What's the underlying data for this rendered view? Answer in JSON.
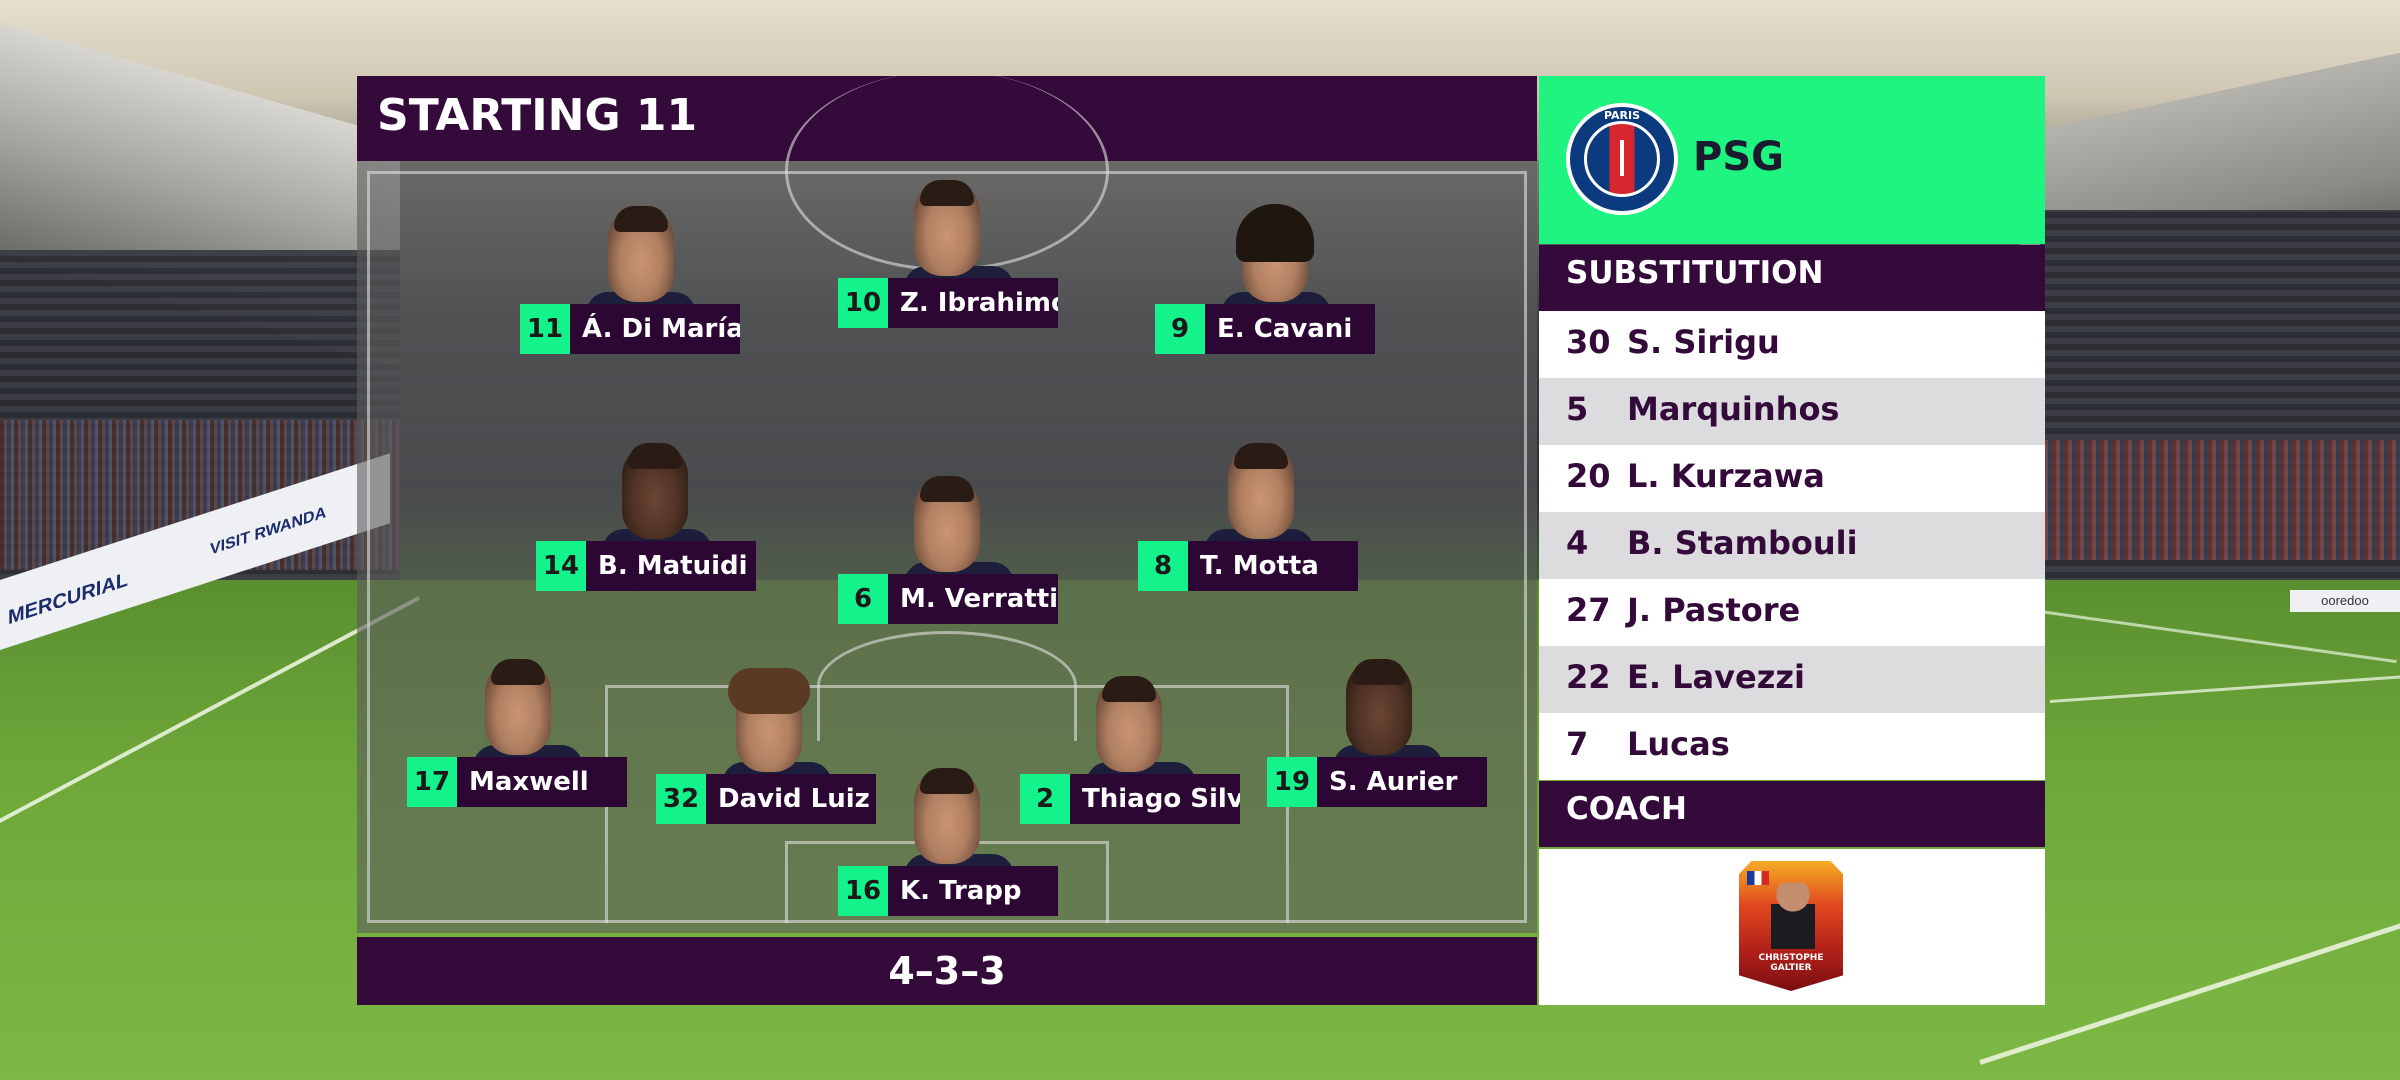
{
  "starting": {
    "title": "STARTING 11",
    "formation": "4–3–3",
    "players": [
      {
        "number": "11",
        "name": "Á. Di María"
      },
      {
        "number": "10",
        "name": "Z. Ibrahimovic"
      },
      {
        "number": "9",
        "name": "E. Cavani"
      },
      {
        "number": "14",
        "name": "B. Matuidi"
      },
      {
        "number": "6",
        "name": "M. Verratti"
      },
      {
        "number": "8",
        "name": "T. Motta"
      },
      {
        "number": "17",
        "name": "Maxwell"
      },
      {
        "number": "32",
        "name": "David Luiz"
      },
      {
        "number": "2",
        "name": "Thiago Silva"
      },
      {
        "number": "19",
        "name": "S. Aurier"
      },
      {
        "number": "16",
        "name": "K. Trapp"
      }
    ]
  },
  "team": {
    "name": "PSG",
    "crest_text": "PARIS"
  },
  "substitution": {
    "title": "SUBSTITUTION",
    "players": [
      {
        "number": "30",
        "name": "S. Sirigu"
      },
      {
        "number": "5",
        "name": "Marquinhos"
      },
      {
        "number": "20",
        "name": "L. Kurzawa"
      },
      {
        "number": "4",
        "name": "B. Stambouli"
      },
      {
        "number": "27",
        "name": "J. Pastore"
      },
      {
        "number": "22",
        "name": "E. Lavezzi"
      },
      {
        "number": "7",
        "name": "Lucas"
      }
    ]
  },
  "coach": {
    "title": "COACH",
    "name": "CHRISTOPHE GALTIER"
  },
  "ads": {
    "left_1": "MERCURIAL",
    "left_2": "VISIT RWANDA",
    "right_1": "ooredoo"
  },
  "colors": {
    "header_purple": "#330a39",
    "number_green": "#14f38b",
    "team_green": "#1ef47f"
  }
}
